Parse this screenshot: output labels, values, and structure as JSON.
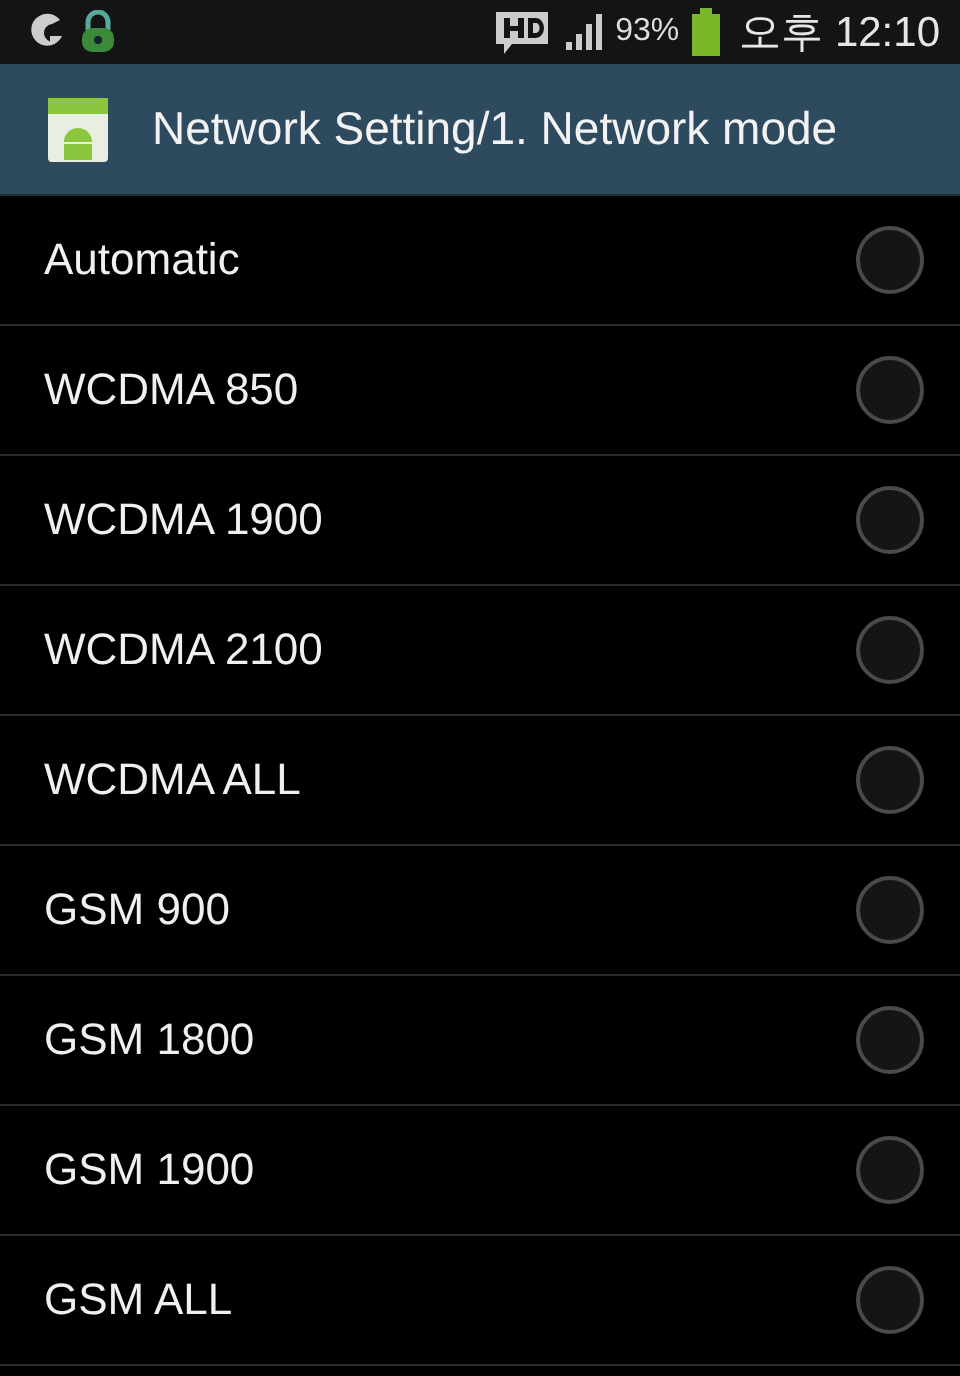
{
  "status_bar": {
    "battery_text": "93%",
    "time": "오후 12:10"
  },
  "title_bar": {
    "title": "Network Setting/1. Network mode"
  },
  "options": [
    {
      "label": "Automatic",
      "selected": false
    },
    {
      "label": "WCDMA 850",
      "selected": false
    },
    {
      "label": "WCDMA 1900",
      "selected": false
    },
    {
      "label": "WCDMA 2100",
      "selected": false
    },
    {
      "label": "WCDMA ALL",
      "selected": false
    },
    {
      "label": "GSM 900",
      "selected": false
    },
    {
      "label": "GSM 1800",
      "selected": false
    },
    {
      "label": "GSM 1900",
      "selected": false
    },
    {
      "label": "GSM ALL",
      "selected": false
    }
  ]
}
